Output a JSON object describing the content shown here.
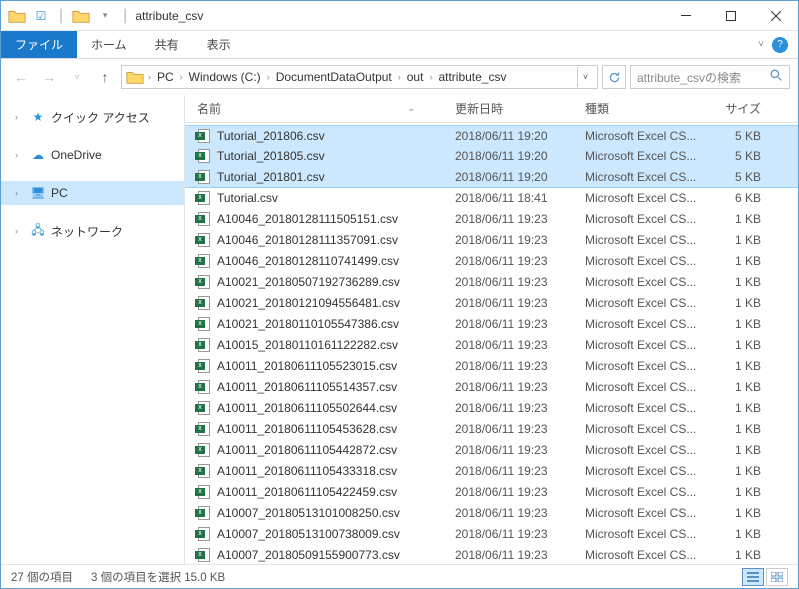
{
  "window": {
    "title": "attribute_csv"
  },
  "ribbon": {
    "file": "ファイル",
    "home": "ホーム",
    "share": "共有",
    "view": "表示"
  },
  "breadcrumb": [
    "PC",
    "Windows (C:)",
    "DocumentDataOutput",
    "out",
    "attribute_csv"
  ],
  "search": {
    "placeholder": "attribute_csvの検索"
  },
  "sidebar": {
    "quick_access": "クイック アクセス",
    "onedrive": "OneDrive",
    "pc": "PC",
    "network": "ネットワーク"
  },
  "columns": {
    "name": "名前",
    "date": "更新日時",
    "type": "種類",
    "size": "サイズ"
  },
  "files": [
    {
      "name": "Tutorial_201806.csv",
      "date": "2018/06/11 19:20",
      "type": "Microsoft Excel CS...",
      "size": "5 KB",
      "selected": true
    },
    {
      "name": "Tutorial_201805.csv",
      "date": "2018/06/11 19:20",
      "type": "Microsoft Excel CS...",
      "size": "5 KB",
      "selected": true
    },
    {
      "name": "Tutorial_201801.csv",
      "date": "2018/06/11 19:20",
      "type": "Microsoft Excel CS...",
      "size": "5 KB",
      "selected": true
    },
    {
      "name": "Tutorial.csv",
      "date": "2018/06/11 18:41",
      "type": "Microsoft Excel CS...",
      "size": "6 KB",
      "selected": false
    },
    {
      "name": "A10046_20180128111505151.csv",
      "date": "2018/06/11 19:23",
      "type": "Microsoft Excel CS...",
      "size": "1 KB",
      "selected": false
    },
    {
      "name": "A10046_20180128111357091.csv",
      "date": "2018/06/11 19:23",
      "type": "Microsoft Excel CS...",
      "size": "1 KB",
      "selected": false
    },
    {
      "name": "A10046_20180128110741499.csv",
      "date": "2018/06/11 19:23",
      "type": "Microsoft Excel CS...",
      "size": "1 KB",
      "selected": false
    },
    {
      "name": "A10021_20180507192736289.csv",
      "date": "2018/06/11 19:23",
      "type": "Microsoft Excel CS...",
      "size": "1 KB",
      "selected": false
    },
    {
      "name": "A10021_20180121094556481.csv",
      "date": "2018/06/11 19:23",
      "type": "Microsoft Excel CS...",
      "size": "1 KB",
      "selected": false
    },
    {
      "name": "A10021_20180110105547386.csv",
      "date": "2018/06/11 19:23",
      "type": "Microsoft Excel CS...",
      "size": "1 KB",
      "selected": false
    },
    {
      "name": "A10015_20180110161122282.csv",
      "date": "2018/06/11 19:23",
      "type": "Microsoft Excel CS...",
      "size": "1 KB",
      "selected": false
    },
    {
      "name": "A10011_20180611105523015.csv",
      "date": "2018/06/11 19:23",
      "type": "Microsoft Excel CS...",
      "size": "1 KB",
      "selected": false
    },
    {
      "name": "A10011_20180611105514357.csv",
      "date": "2018/06/11 19:23",
      "type": "Microsoft Excel CS...",
      "size": "1 KB",
      "selected": false
    },
    {
      "name": "A10011_20180611105502644.csv",
      "date": "2018/06/11 19:23",
      "type": "Microsoft Excel CS...",
      "size": "1 KB",
      "selected": false
    },
    {
      "name": "A10011_20180611105453628.csv",
      "date": "2018/06/11 19:23",
      "type": "Microsoft Excel CS...",
      "size": "1 KB",
      "selected": false
    },
    {
      "name": "A10011_20180611105442872.csv",
      "date": "2018/06/11 19:23",
      "type": "Microsoft Excel CS...",
      "size": "1 KB",
      "selected": false
    },
    {
      "name": "A10011_20180611105433318.csv",
      "date": "2018/06/11 19:23",
      "type": "Microsoft Excel CS...",
      "size": "1 KB",
      "selected": false
    },
    {
      "name": "A10011_20180611105422459.csv",
      "date": "2018/06/11 19:23",
      "type": "Microsoft Excel CS...",
      "size": "1 KB",
      "selected": false
    },
    {
      "name": "A10007_20180513101008250.csv",
      "date": "2018/06/11 19:23",
      "type": "Microsoft Excel CS...",
      "size": "1 KB",
      "selected": false
    },
    {
      "name": "A10007_20180513100738009.csv",
      "date": "2018/06/11 19:23",
      "type": "Microsoft Excel CS...",
      "size": "1 KB",
      "selected": false
    },
    {
      "name": "A10007_20180509155900773.csv",
      "date": "2018/06/11 19:23",
      "type": "Microsoft Excel CS...",
      "size": "1 KB",
      "selected": false
    }
  ],
  "status": {
    "count": "27 個の項目",
    "selected": "3 個の項目を選択 15.0 KB"
  }
}
